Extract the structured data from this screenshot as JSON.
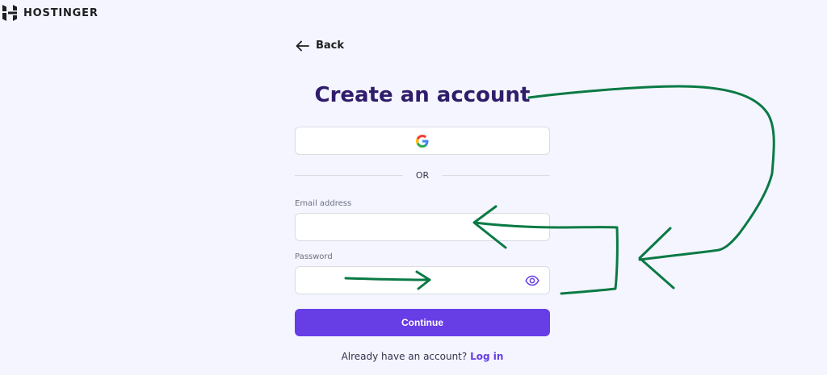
{
  "brand": {
    "name": "HOSTINGER",
    "logo_icon": "hostinger-logo-icon"
  },
  "nav": {
    "back_label": "Back",
    "back_icon": "arrow-left-icon"
  },
  "page": {
    "title": "Create an account"
  },
  "social": {
    "google_icon": "google-icon"
  },
  "divider": {
    "text": "OR"
  },
  "form": {
    "email_label": "Email address",
    "email_value": "",
    "password_label": "Password",
    "password_value": "",
    "password_toggle_icon": "eye-icon",
    "continue_label": "Continue"
  },
  "footer": {
    "prompt": "Already have an account?",
    "login_label": "Log in"
  },
  "colors": {
    "background": "#f4f5ff",
    "title": "#2f1c6a",
    "accent": "#673de6",
    "annotation": "#0a7a44"
  },
  "annotations": {
    "description_icon": "hand-drawn-green-arrows-icon"
  }
}
